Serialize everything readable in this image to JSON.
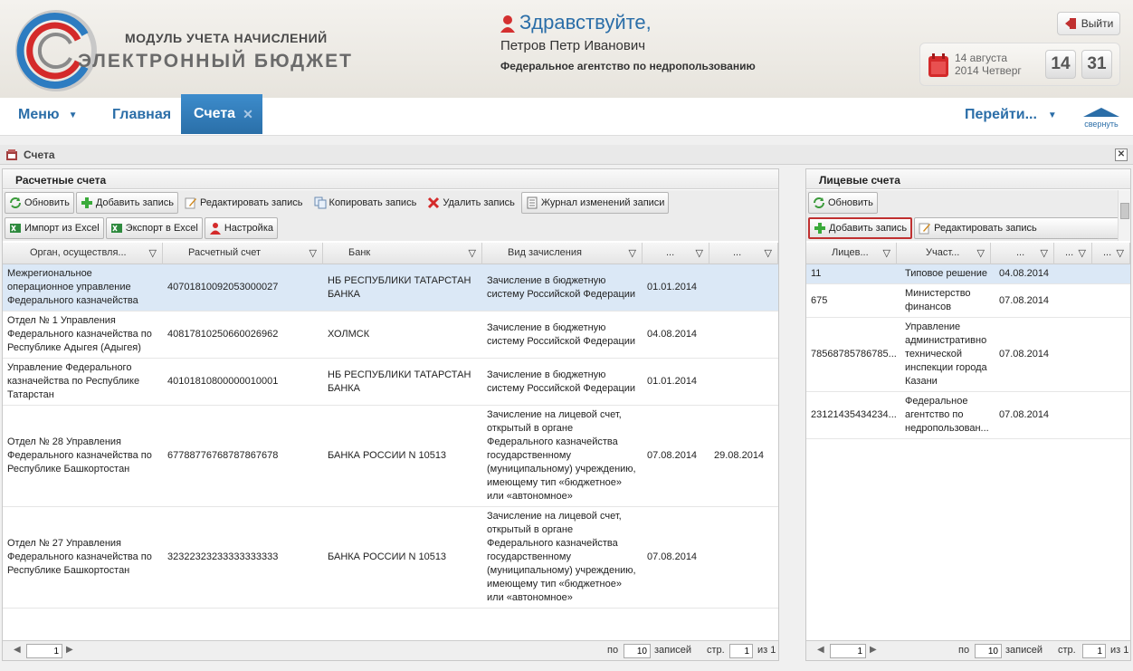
{
  "header": {
    "app_line1": "МОДУЛЬ УЧЕТА НАЧИСЛЕНИЙ",
    "app_line2": "ЭЛЕКТРОННЫЙ БЮДЖЕТ",
    "greeting": "Здравствуйте,",
    "user_name": "Петров Петр Иванович",
    "organization": "Федеральное агентство по недропользованию",
    "logout_label": "Выйти",
    "date_line1": "14 августа",
    "date_line2": "2014 Четверг",
    "time_hours": "14",
    "time_minutes": "31"
  },
  "nav": {
    "menu_label": "Меню",
    "home_label": "Главная",
    "active_tab": "Счета",
    "goto_label": "Перейти...",
    "collapse_label": "свернуть"
  },
  "page": {
    "title": "Счета"
  },
  "left": {
    "title": "Расчетные счета",
    "toolbar1": [
      "Обновить",
      "Добавить запись",
      "Редактировать запись",
      "Копировать запись",
      "Удалить запись",
      "Журнал изменений записи"
    ],
    "toolbar2": [
      "Импорт из Excel",
      "Экспорт в Excel",
      "Настройка"
    ],
    "columns": [
      "Орган, осуществля...",
      "Расчетный счет",
      "Банк",
      "Вид зачисления",
      "...",
      "..."
    ],
    "rows": [
      [
        "Межрегиональное операционное управление Федерального казначейства",
        "40701810092053000027",
        "НБ РЕСПУБЛИКИ ТАТАРСТАН БАНКА",
        "Зачисление в бюджетную систему Российской Федерации",
        "01.01.2014",
        ""
      ],
      [
        "Отдел № 1 Управления Федерального казначейства по Республике Адыгея (Адыгея)",
        "40817810250660026962",
        "ХОЛМСК",
        "Зачисление в бюджетную систему Российской Федерации",
        "04.08.2014",
        ""
      ],
      [
        "Управление Федерального казначейства по Республике Татарстан",
        "40101810800000010001",
        "НБ РЕСПУБЛИКИ ТАТАРСТАН БАНКА",
        "Зачисление в бюджетную систему Российской Федерации",
        "01.01.2014",
        ""
      ],
      [
        "Отдел № 28 Управления Федерального казначейства по Республике Башкортостан",
        "67788776768787867678",
        "БАНКА РОССИИ N 10513",
        "Зачисление на лицевой счет, открытый в органе Федерального казначейства государственному (муниципальному) учреждению, имеющему тип «бюджетное» или «автономное»",
        "07.08.2014",
        "29.08.2014"
      ],
      [
        "Отдел № 27 Управления Федерального казначейства по Республике Башкортостан",
        "32322323233333333333",
        "БАНКА РОССИИ N 10513",
        "Зачисление на лицевой счет, открытый в органе Федерального казначейства государственному (муниципальному) учреждению, имеющему тип «бюджетное» или «автономное»",
        "07.08.2014",
        ""
      ]
    ],
    "pager": {
      "page": "1",
      "per_page_prefix": "по",
      "per_page": "10",
      "records": "записей",
      "page_label": "стр.",
      "page_num": "1",
      "of": "из 1"
    }
  },
  "right": {
    "title": "Лицевые счета",
    "toolbar1": [
      "Обновить"
    ],
    "toolbar2": [
      "Добавить запись",
      "Редактировать запись"
    ],
    "columns": [
      "Лицев...",
      "Участ...",
      "...",
      "...",
      "..."
    ],
    "rows": [
      [
        "11",
        "Типовое решение",
        "04.08.2014"
      ],
      [
        "675",
        "Министерство финансов",
        "07.08.2014"
      ],
      [
        "78568785786785...",
        "Управление административно технической инспекции города Казани",
        "07.08.2014"
      ],
      [
        "23121435434234...",
        "Федеральное агентство по недропользован...",
        "07.08.2014"
      ]
    ],
    "pager": {
      "page": "1",
      "per_page_prefix": "по",
      "per_page": "10",
      "records": "записей",
      "page_label": "стр.",
      "page_num": "1",
      "of": "из 1"
    }
  },
  "colors": {
    "accent": "#2b6ea8",
    "active_tab": "#3380c0",
    "selected_row": "#dbe8f6",
    "highlight_border": "#c03030"
  }
}
